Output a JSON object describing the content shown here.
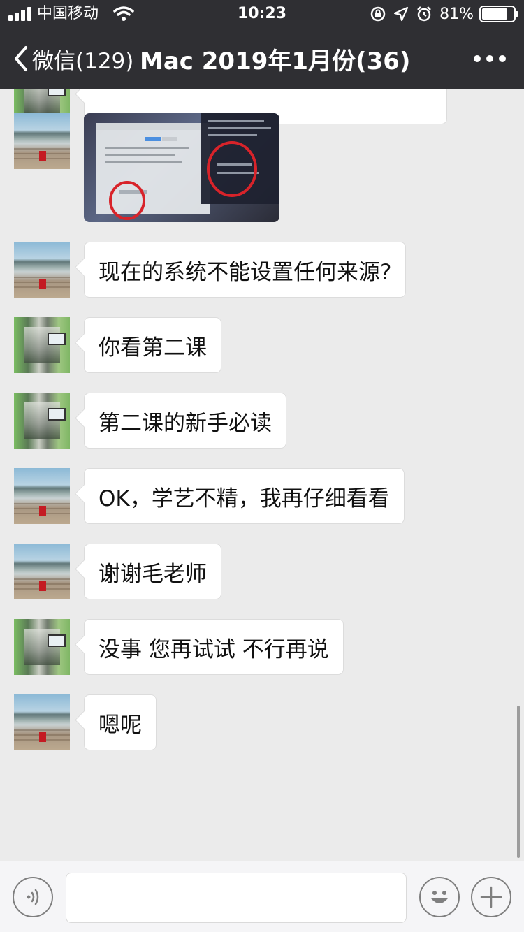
{
  "status_bar": {
    "carrier": "中国移动",
    "time": "10:23",
    "battery_percent": "81%",
    "battery_level": 0.81
  },
  "nav": {
    "back_label": "微信(129)",
    "title": "Mac 2019年1月份(36)"
  },
  "messages": [
    {
      "sender": "beach",
      "type": "image",
      "icon": "screenshot-photo"
    },
    {
      "sender": "beach",
      "type": "text",
      "text": "现在的系统不能设置任何来源?"
    },
    {
      "sender": "lab",
      "type": "text",
      "text": "你看第二课"
    },
    {
      "sender": "lab",
      "type": "text",
      "text": "第二课的新手必读"
    },
    {
      "sender": "beach",
      "type": "text",
      "text": "OK，学艺不精，我再仔细看看"
    },
    {
      "sender": "beach",
      "type": "text",
      "text": "谢谢毛老师"
    },
    {
      "sender": "lab",
      "type": "text",
      "text": "没事 您再试试 不行再说"
    },
    {
      "sender": "beach",
      "type": "text",
      "text": "嗯呢"
    }
  ],
  "input_bar": {
    "voice_icon": "voice-icon",
    "emoji_icon": "emoji-icon",
    "plus_icon": "plus-icon"
  },
  "colors": {
    "header_bg": "#2f2f33",
    "chat_bg": "#ebebeb",
    "bubble_bg": "#ffffff"
  }
}
